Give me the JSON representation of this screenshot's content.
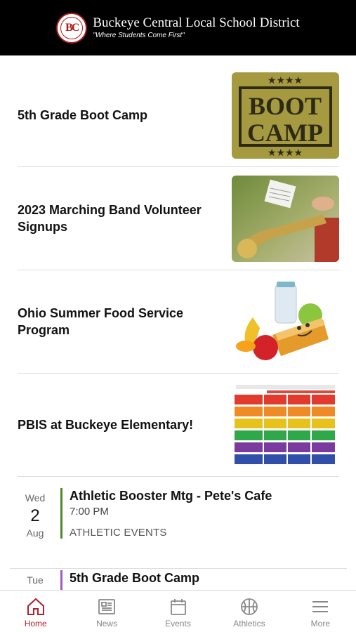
{
  "header": {
    "logo_letters": "BC",
    "district_name": "Buckeye Central Local School District",
    "tagline": "\"Where Students Come First\""
  },
  "news": [
    {
      "title": "5th Grade Boot Camp",
      "image_icon": "boot-camp-stamp-image",
      "image_text": "BOOT CAMP"
    },
    {
      "title": "2023 Marching Band Volunteer Signups",
      "image_icon": "trumpet-photo"
    },
    {
      "title": "Ohio Summer Food Service Program",
      "image_icon": "food-illustration"
    },
    {
      "title": "PBIS at Buckeye Elementary!",
      "image_icon": "pbis-matrix-image"
    }
  ],
  "events": [
    {
      "dow": "Wed",
      "day": "2",
      "month": "Aug",
      "title": "Athletic Booster Mtg - Pete's Cafe",
      "time": "7:00 PM",
      "category": "ATHLETIC EVENTS",
      "color": "#4a8a2a"
    },
    {
      "dow": "Tue",
      "title": "5th Grade Boot Camp",
      "color": "#a35ac8"
    }
  ],
  "tabs": [
    {
      "label": "Home",
      "icon": "home-icon",
      "active": true
    },
    {
      "label": "News",
      "icon": "newspaper-icon",
      "active": false
    },
    {
      "label": "Events",
      "icon": "calendar-icon",
      "active": false
    },
    {
      "label": "Athletics",
      "icon": "basketball-icon",
      "active": false
    },
    {
      "label": "More",
      "icon": "menu-icon",
      "active": false
    }
  ],
  "colors": {
    "accent": "#b21e2b",
    "header_bg": "#000000"
  }
}
